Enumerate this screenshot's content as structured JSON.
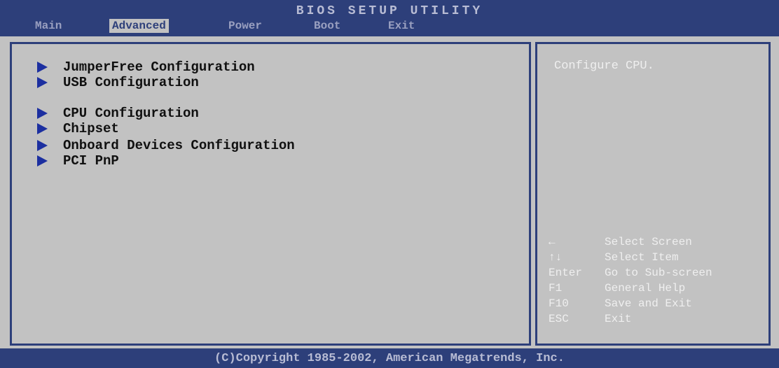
{
  "header": {
    "title": "BIOS SETUP UTILITY",
    "tabs": [
      "Main",
      "Advanced",
      "Power",
      "Boot",
      "Exit"
    ]
  },
  "menu": {
    "items": [
      "JumperFree Configuration",
      "USB Configuration",
      "CPU Configuration",
      "Chipset",
      "Onboard Devices Configuration",
      "PCI PnP"
    ]
  },
  "help": {
    "text": "Configure CPU.",
    "keys": [
      {
        "key": "←",
        "desc": "Select Screen"
      },
      {
        "key": "↑↓",
        "desc": "Select Item"
      },
      {
        "key": "Enter",
        "desc": "Go to Sub-screen"
      },
      {
        "key": "F1",
        "desc": "General Help"
      },
      {
        "key": "F10",
        "desc": "Save and Exit"
      },
      {
        "key": "ESC",
        "desc": "Exit"
      }
    ]
  },
  "footer": {
    "copyright": "(C)Copyright 1985-2002, American Megatrends, Inc."
  },
  "colors": {
    "bar": "#2d3f7a",
    "panel": "#c2c2c2",
    "arrow": "#1c2fa0"
  }
}
